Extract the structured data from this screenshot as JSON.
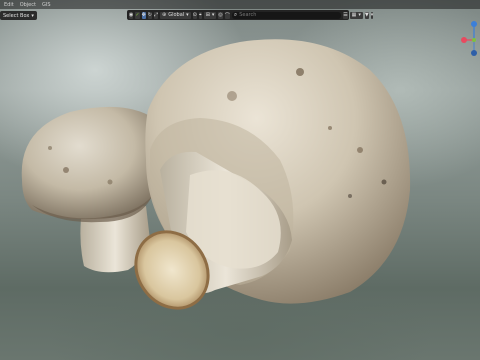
{
  "menubar": {
    "items": [
      "Edit",
      "Object",
      "GIS"
    ]
  },
  "select_mode": {
    "label": "Select Box"
  },
  "toolbar": {
    "transform_orientation": "Global",
    "search_placeholder": "Search"
  },
  "colors": {
    "axis_x": "#e84a5f",
    "axis_y": "#7fbf3f",
    "axis_z": "#3b7fd9",
    "toolbar_active": "#4a6fa5"
  }
}
